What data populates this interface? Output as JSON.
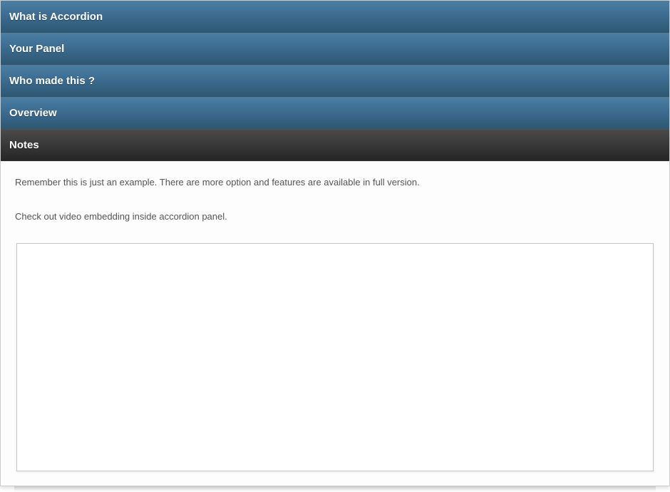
{
  "accordion": {
    "items": [
      {
        "title": "What is Accordion"
      },
      {
        "title": "Your Panel"
      },
      {
        "title": "Who made this ?"
      },
      {
        "title": "Overview"
      },
      {
        "title": "Notes"
      }
    ]
  },
  "panel": {
    "notes": {
      "line1": "Remember this is just an example. There are more option and features are available in full version.",
      "line2": "Check out video embedding inside accordion panel."
    }
  }
}
